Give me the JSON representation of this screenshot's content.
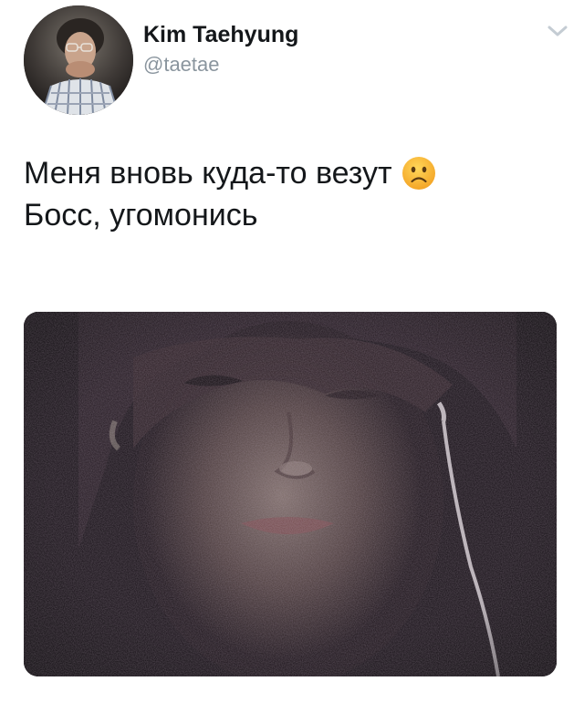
{
  "author": {
    "display_name": "Kim Taehyung",
    "handle": "@taetae",
    "avatar_icon": "profile-photo"
  },
  "menu": {
    "icon": "chevron-down-icon",
    "color": "#c4ccd3"
  },
  "tweet": {
    "line1": "Меня вновь куда-то везут",
    "emoji": "frowning-face",
    "line2": "Босс, угомонись"
  },
  "media": {
    "type": "photo",
    "description_icon": "selfie-photo"
  },
  "colors": {
    "text": "#14171a",
    "secondary": "#8a959e",
    "emoji_fill": "#f8c03c"
  }
}
